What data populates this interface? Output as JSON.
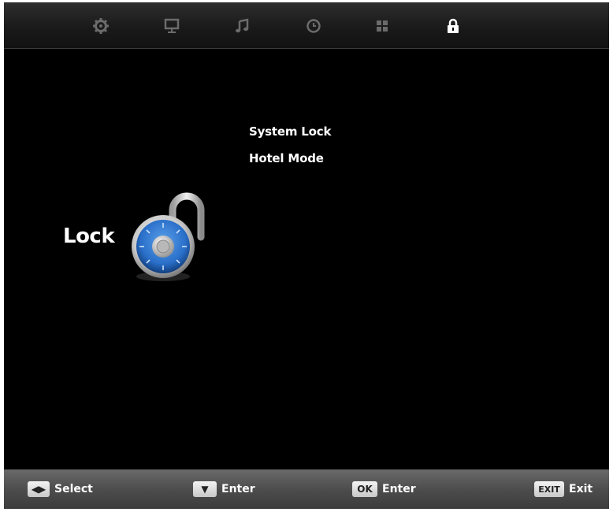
{
  "tabs": [
    {
      "id": "setup",
      "icon": "gear-icon",
      "active": false
    },
    {
      "id": "picture",
      "icon": "monitor-icon",
      "active": false
    },
    {
      "id": "sound",
      "icon": "music-note-icon",
      "active": false
    },
    {
      "id": "time",
      "icon": "clock-icon",
      "active": false
    },
    {
      "id": "option",
      "icon": "grid-icon",
      "active": false
    },
    {
      "id": "lock",
      "icon": "lock-icon",
      "active": true
    }
  ],
  "category": {
    "label": "Lock",
    "icon": "padlock-dial-icon"
  },
  "menu": {
    "items": [
      {
        "label": "System Lock"
      },
      {
        "label": "Hotel Mode"
      }
    ]
  },
  "hints": [
    {
      "key": "◀▶",
      "key_icon": "left-right-arrows-icon",
      "label": "Select"
    },
    {
      "key": "▼",
      "key_icon": "down-arrow-icon",
      "label": "Enter"
    },
    {
      "key": "OK",
      "label": "Enter"
    },
    {
      "key": "EXIT",
      "label": "Exit"
    }
  ],
  "colors": {
    "background": "#000000",
    "tab_inactive": "#6b6b6b",
    "tab_active": "#ffffff",
    "dial": "#2a6fc9"
  }
}
